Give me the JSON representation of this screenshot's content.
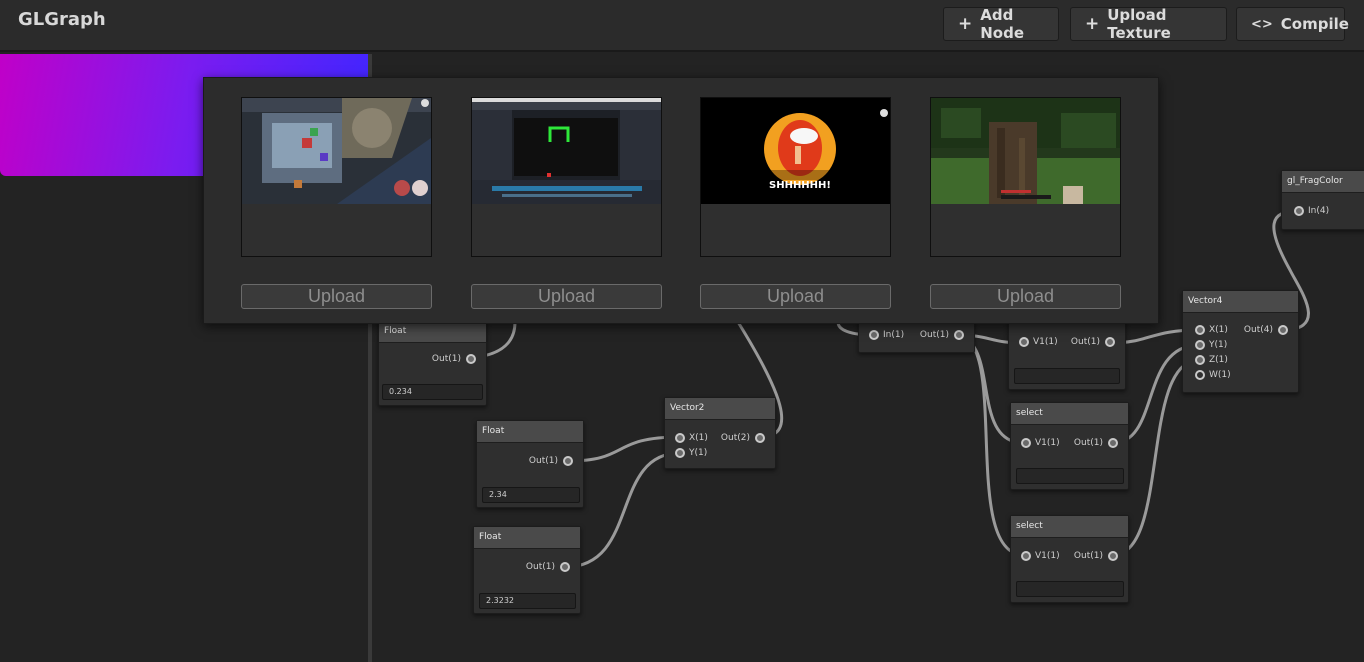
{
  "app": {
    "title": "GLGraph"
  },
  "toolbar": {
    "add_node_label": "Add Node",
    "upload_texture_label": "Upload Texture",
    "compile_label": "Compile",
    "add_icon": "+",
    "compile_icon": "<>"
  },
  "texture_modal": {
    "upload_label": "Upload",
    "slots": [
      {
        "image": "among-us-map-screenshot"
      },
      {
        "image": "game-editor-screenshot"
      },
      {
        "image": "among-us-shhh-sticker",
        "caption": "SHHHHHH!"
      },
      {
        "image": "minecraft-forest-screenshot"
      }
    ]
  },
  "nodes": {
    "float_a": {
      "title": "Float",
      "out": "Out(1)",
      "value": "0.234"
    },
    "float_b": {
      "title": "Float",
      "out": "Out(1)",
      "value": "2.34"
    },
    "float_c": {
      "title": "Float",
      "out": "Out(1)",
      "value": "2.3232"
    },
    "vector2": {
      "title": "Vector2",
      "in_x": "X(1)",
      "in_y": "Y(1)",
      "out": "Out(2)"
    },
    "swizzle": {
      "in": "In(1)",
      "out": "Out(1)"
    },
    "select_a": {
      "in": "V1(1)",
      "out": "Out(1)"
    },
    "select_b": {
      "title": "select",
      "in": "V1(1)",
      "out": "Out(1)"
    },
    "select_c": {
      "title": "select",
      "in": "V1(1)",
      "out": "Out(1)"
    },
    "vector4": {
      "title": "Vector4",
      "in_x": "X(1)",
      "in_y": "Y(1)",
      "in_z": "Z(1)",
      "in_w": "W(1)",
      "out": "Out(4)"
    },
    "frag": {
      "title": "gl_FragColor",
      "in": "In(4)"
    }
  },
  "colors": {
    "background": "#232323",
    "header": "#2b2b2b",
    "node_header": "#4a4a4a",
    "wire": "#9a9a9a",
    "preview_gradient_start": "#c000c8",
    "preview_gradient_end": "#3f26ff"
  }
}
